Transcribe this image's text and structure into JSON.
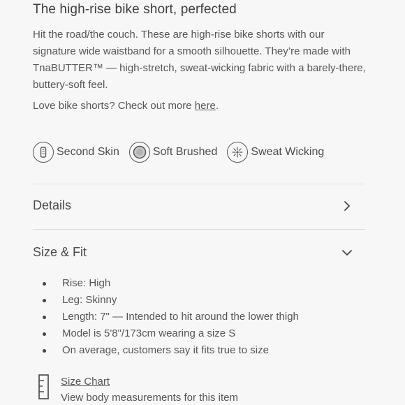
{
  "product": {
    "title": "The high-rise bike short, perfected",
    "description": "Hit the road/the couch. These are high-rise bike shorts with our signature wide waistband for a smooth silhouette. They’re made with TnaBUTTER™ — high-stretch, sweat-wicking fabric with a barely-there, buttery-soft feel.",
    "more_prefix": "Love bike shorts? Check out more ",
    "more_link": "here",
    "more_suffix": "."
  },
  "features": [
    {
      "label": "Second Skin",
      "icon": "second-skin-icon"
    },
    {
      "label": "Soft Brushed",
      "icon": "soft-brushed-icon"
    },
    {
      "label": "Sweat Wicking",
      "icon": "sweat-wicking-icon"
    }
  ],
  "accordions": {
    "details": {
      "label": "Details",
      "icon": "chevron-right-icon"
    },
    "size_fit": {
      "label": "Size & Fit",
      "icon": "chevron-down-icon"
    }
  },
  "size_fit_items": [
    "Rise: High",
    "Leg: Skinny",
    "Length: 7\" — Intended to hit around the lower thigh",
    "Model is 5'8\"/173cm wearing a size S",
    "On average, customers say it fits true to size"
  ],
  "size_chart": {
    "link": "Size Chart",
    "caption": "View body measurements for this item",
    "icon": "ruler-icon"
  }
}
